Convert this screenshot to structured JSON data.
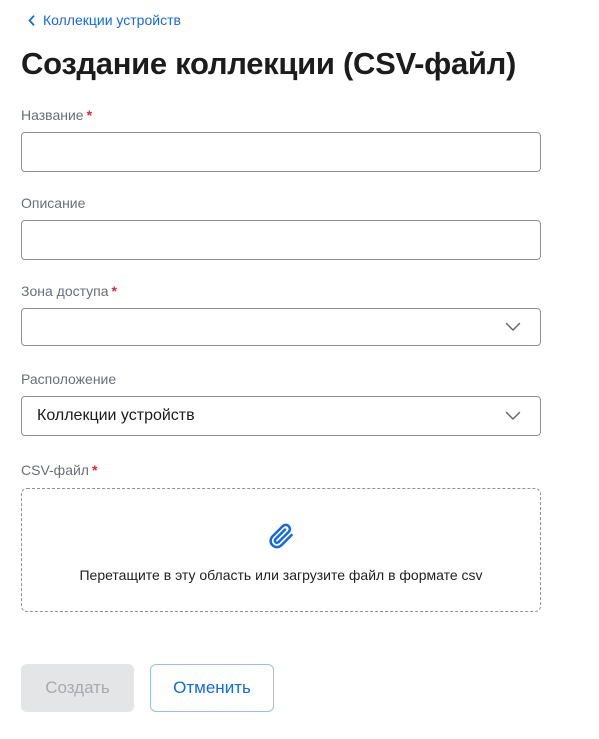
{
  "back_link": {
    "label": "Коллекции устройств"
  },
  "page": {
    "title": "Создание коллекции (CSV-файл)"
  },
  "fields": {
    "name": {
      "label": "Название",
      "required_mark": "*",
      "value": ""
    },
    "description": {
      "label": "Описание",
      "value": ""
    },
    "access_zone": {
      "label": "Зона доступа",
      "required_mark": "*",
      "value": ""
    },
    "location": {
      "label": "Расположение",
      "value": "Коллекции устройств"
    },
    "csv_file": {
      "label": "CSV-файл",
      "required_mark": "*",
      "dropzone_text": "Перетащите в эту область или загрузите файл в формате csv"
    }
  },
  "buttons": {
    "create": "Создать",
    "cancel": "Отменить"
  },
  "colors": {
    "accent": "#1769e0",
    "required": "#e0283a",
    "disabled_bg": "#e4e5e7",
    "disabled_text": "#a6a9ae"
  },
  "icons": {
    "back": "chevron-left-icon",
    "dropdown": "chevron-down-icon",
    "attach": "paperclip-icon"
  }
}
